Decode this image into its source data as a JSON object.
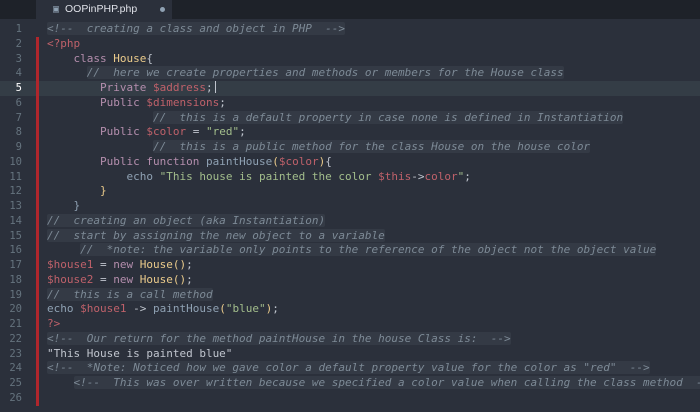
{
  "tab": {
    "file_name": "OOPinPHP.php",
    "icon": "file-icon",
    "modified": true
  },
  "editor": {
    "current_line": 5,
    "lines": [
      {
        "n": "1",
        "t": [
          [
            "cm",
            "<!--  creating a class and object in PHP  -->"
          ]
        ]
      },
      {
        "n": "2",
        "t": [
          [
            "var",
            "<?php"
          ]
        ]
      },
      {
        "n": "3",
        "t": [
          [
            "sp",
            "    "
          ],
          [
            "kw",
            "class"
          ],
          [
            "pn",
            " "
          ],
          [
            "cls",
            "House"
          ],
          [
            "pn",
            "{"
          ]
        ]
      },
      {
        "n": "4",
        "t": [
          [
            "sp",
            "      "
          ],
          [
            "cm",
            "//  here we create properties and methods or members for the House class"
          ]
        ]
      },
      {
        "n": "5",
        "t": [
          [
            "sp",
            "        "
          ],
          [
            "kw",
            "Private"
          ],
          [
            "pn",
            " "
          ],
          [
            "var",
            "$address"
          ],
          [
            "pn",
            ";"
          ]
        ]
      },
      {
        "n": "6",
        "t": [
          [
            "sp",
            "        "
          ],
          [
            "kw",
            "Public"
          ],
          [
            "pn",
            " "
          ],
          [
            "var",
            "$dimensions"
          ],
          [
            "pn",
            ";"
          ]
        ]
      },
      {
        "n": "7",
        "t": [
          [
            "sp",
            "                "
          ],
          [
            "cm",
            "//  this is a default property in case none is defined in Instantiation"
          ]
        ]
      },
      {
        "n": "8",
        "t": [
          [
            "sp",
            "        "
          ],
          [
            "kw",
            "Public"
          ],
          [
            "pn",
            " "
          ],
          [
            "var",
            "$color"
          ],
          [
            "pn",
            " = "
          ],
          [
            "str",
            "\"red\""
          ],
          [
            "pn",
            ";"
          ]
        ]
      },
      {
        "n": "9",
        "t": [
          [
            "sp",
            "                "
          ],
          [
            "cm",
            "//  this is a public method for the class House on the house color"
          ]
        ]
      },
      {
        "n": "10",
        "t": [
          [
            "sp",
            "        "
          ],
          [
            "kw",
            "Public"
          ],
          [
            "pn",
            " "
          ],
          [
            "kw",
            "function"
          ],
          [
            "pn",
            " "
          ],
          [
            "fn",
            "paintHouse"
          ],
          [
            "br",
            "("
          ],
          [
            "var",
            "$color"
          ],
          [
            "br",
            ")"
          ],
          [
            "pn",
            "{"
          ]
        ]
      },
      {
        "n": "11",
        "t": [
          [
            "sp",
            "            "
          ],
          [
            "fn",
            "echo"
          ],
          [
            "pn",
            " "
          ],
          [
            "str",
            "\"This house is painted the color "
          ],
          [
            "var",
            "$this"
          ],
          [
            "pn",
            "->"
          ],
          [
            "var",
            "color"
          ],
          [
            "str",
            "\""
          ],
          [
            "pn",
            ";"
          ]
        ]
      },
      {
        "n": "12",
        "t": [
          [
            "sp",
            "        "
          ],
          [
            "br",
            "}"
          ]
        ]
      },
      {
        "n": "13",
        "t": [
          [
            "sp",
            "    "
          ],
          [
            "fn",
            "}"
          ]
        ]
      },
      {
        "n": "14",
        "t": [
          [
            "cm",
            "//  creating an object (aka Instantiation)"
          ]
        ]
      },
      {
        "n": "15",
        "t": [
          [
            "cm",
            "//  start by assigning the new object to a variable"
          ]
        ]
      },
      {
        "n": "16",
        "t": [
          [
            "sp",
            "     "
          ],
          [
            "cm",
            "//  *note: the variable only points to the reference of the object not the object value"
          ]
        ]
      },
      {
        "n": "17",
        "t": [
          [
            "var",
            "$house1"
          ],
          [
            "pn",
            " = "
          ],
          [
            "kw",
            "new"
          ],
          [
            "pn",
            " "
          ],
          [
            "cls",
            "House"
          ],
          [
            "br",
            "()"
          ],
          [
            "pn",
            ";"
          ]
        ]
      },
      {
        "n": "18",
        "t": [
          [
            "var",
            "$house2"
          ],
          [
            "pn",
            " = "
          ],
          [
            "kw",
            "new"
          ],
          [
            "pn",
            " "
          ],
          [
            "cls",
            "House"
          ],
          [
            "br",
            "()"
          ],
          [
            "pn",
            ";"
          ]
        ]
      },
      {
        "n": "19",
        "t": [
          [
            "cm",
            "//  this is a call method"
          ]
        ]
      },
      {
        "n": "20",
        "t": [
          [
            "fn",
            "echo"
          ],
          [
            "pn",
            " "
          ],
          [
            "var",
            "$house1"
          ],
          [
            "pn",
            " -> "
          ],
          [
            "fn",
            "paintHouse"
          ],
          [
            "br",
            "("
          ],
          [
            "str",
            "\"blue\""
          ],
          [
            "br",
            ")"
          ],
          [
            "pn",
            ";"
          ]
        ]
      },
      {
        "n": "21",
        "t": [
          [
            "var",
            "?>"
          ]
        ]
      },
      {
        "n": "22",
        "t": [
          [
            "cm",
            "<!--  Our return for the method paintHouse in the house Class is:  -->"
          ]
        ]
      },
      {
        "n": "23",
        "t": [
          [
            "pn",
            "\"This House is painted blue\""
          ]
        ]
      },
      {
        "n": "24",
        "t": [
          [
            "cm",
            "<!--  *Note: Noticed how we gave color a default property value for the color as \"red\"  -->"
          ]
        ]
      },
      {
        "n": "25",
        "t": [
          [
            "sp",
            "    "
          ],
          [
            "cm",
            "<!--  This was over written because we specified a color value when calling the class method  -->"
          ]
        ]
      },
      {
        "n": "26",
        "t": []
      }
    ]
  },
  "colors": {
    "background": "#2b303b",
    "comment": "#7d8a96",
    "keyword": "#b48ead",
    "variable": "#bf616a",
    "string": "#a3be8c",
    "function": "#8fa1b3",
    "class": "#ebcb8b",
    "gutter_marker": "#b0262c",
    "current_line_number_bg": "#2e8b57"
  }
}
